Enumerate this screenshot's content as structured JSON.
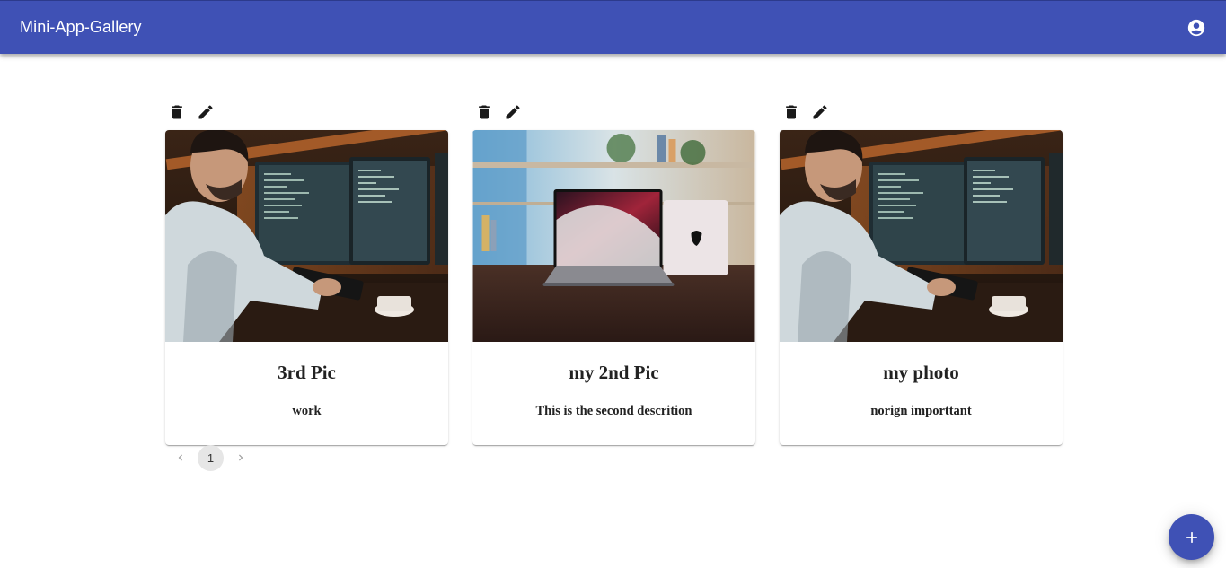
{
  "app": {
    "title": "Mini-App-Gallery",
    "brand_color": "#3f51b5",
    "account_icon": "account-circle-icon"
  },
  "cards": [
    {
      "title": "3rd Pic",
      "description": "work",
      "image": "man-at-computer-photo"
    },
    {
      "title": "my 2nd Pic",
      "description": "This is the second descrition",
      "image": "laptop-on-desk-photo"
    },
    {
      "title": "my photo",
      "description": "norign importtant",
      "image": "man-at-computer-photo"
    }
  ],
  "card_actions": {
    "delete_icon": "trash-icon",
    "edit_icon": "pencil-icon"
  },
  "pagination": {
    "current_page": "1",
    "prev_icon": "chevron-left-icon",
    "next_icon": "chevron-right-icon"
  },
  "fab": {
    "icon": "plus-icon"
  }
}
